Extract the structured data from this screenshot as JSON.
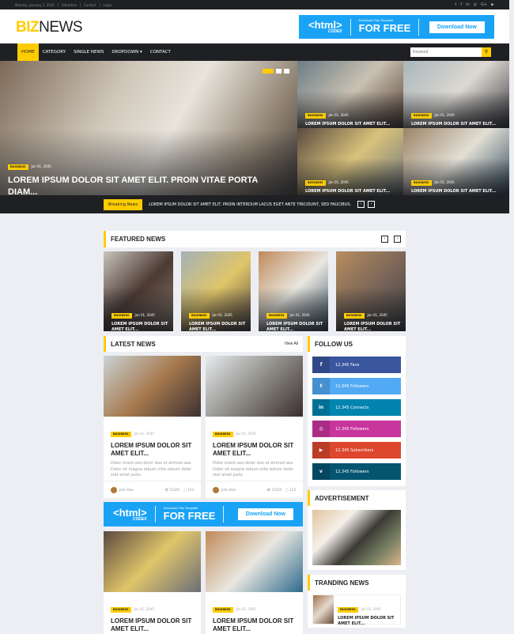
{
  "topbar": {
    "date": "Monday, January 1, 2045",
    "links": [
      "Advertise",
      "Contact",
      "Login"
    ],
    "social_icons": [
      "twitter-icon",
      "facebook-icon",
      "linkedin-icon",
      "instagram-icon",
      "google-plus-icon",
      "youtube-icon"
    ]
  },
  "logo": {
    "part1": "BIZ",
    "part2": "NEWS"
  },
  "banner": {
    "brand": "<html>",
    "brand_sub": "CODEX",
    "small": "Download This Template",
    "big": "FOR FREE",
    "button": "Download Now"
  },
  "nav": {
    "items": [
      "HOME",
      "CATEGORY",
      "SINGLE NEWS",
      "DROPDOWN ▾",
      "CONTACT"
    ],
    "active": "HOME",
    "search_placeholder": "Keyword"
  },
  "hero": {
    "main": {
      "tag": "BUSINESS",
      "date": "Jan 01, 2045",
      "title": "LOREM IPSUM DOLOR SIT AMET ELIT. PROIN VITAE PORTA DIAM..."
    },
    "tiles": [
      {
        "tag": "BUSINESS",
        "date": "Jan 01, 2045",
        "title": "LOREM IPSUM DOLOR SIT AMET ELIT..."
      },
      {
        "tag": "BUSINESS",
        "date": "Jan 01, 2045",
        "title": "LOREM IPSUM DOLOR SIT AMET ELIT..."
      },
      {
        "tag": "BUSINESS",
        "date": "Jan 01, 2045",
        "title": "LOREM IPSUM DOLOR SIT AMET ELIT..."
      },
      {
        "tag": "BUSINESS",
        "date": "Jan 01, 2045",
        "title": "LOREM IPSUM DOLOR SIT AMET ELIT..."
      }
    ]
  },
  "breaking": {
    "label": "Breaking News",
    "text": "LOREM IPSUM DOLOR SIT AMET ELIT. PROIN INTERDUM LACUS EGET ANTE TINCIDUNT, SED FAUCIBUS."
  },
  "featured": {
    "title": "FEATURED NEWS",
    "items": [
      {
        "tag": "BUSINESS",
        "date": "Jan 01, 2045",
        "title": "LOREM IPSUM DOLOR SIT AMET ELIT..."
      },
      {
        "tag": "BUSINESS",
        "date": "Jan 01, 2045",
        "title": "LOREM IPSUM DOLOR SIT AMET ELIT..."
      },
      {
        "tag": "BUSINESS",
        "date": "Jan 01, 2045",
        "title": "LOREM IPSUM DOLOR SIT AMET ELIT..."
      },
      {
        "tag": "BUSINESS",
        "date": "Jan 01, 2045",
        "title": "LOREM IPSUM DOLOR SIT AMET ELIT..."
      }
    ]
  },
  "latest": {
    "title": "LATEST NEWS",
    "view_all": "View All",
    "items": [
      {
        "tag": "BUSINESS",
        "date": "Jan 01, 2045",
        "title": "LOREM IPSUM DOLOR SIT AMET ELIT...",
        "desc": "Dolor lorem eos dolor duo et eirmod sea. Dolor sit magna rebum clita rebum dolor stet amet justo",
        "author": "John Doe",
        "views": "12345",
        "comments": "123"
      },
      {
        "tag": "BUSINESS",
        "date": "Jan 01, 2045",
        "title": "LOREM IPSUM DOLOR SIT AMET ELIT...",
        "desc": "Dolor lorem eos dolor duo et eirmod sea. Dolor sit magna rebum clita rebum dolor stet amet justo",
        "author": "John Doe",
        "views": "12345",
        "comments": "123"
      },
      {
        "tag": "BUSINESS",
        "date": "Jan 01, 2045",
        "title": "LOREM IPSUM DOLOR SIT AMET ELIT..."
      },
      {
        "tag": "BUSINESS",
        "date": "Jan 01, 2045",
        "title": "LOREM IPSUM DOLOR SIT AMET ELIT..."
      }
    ]
  },
  "follow": {
    "title": "FOLLOW US",
    "items": [
      {
        "icon": "f",
        "label": "12,345 Fans",
        "color": "#39569e"
      },
      {
        "icon": "t",
        "label": "12,345 Followers",
        "color": "#52aaf4"
      },
      {
        "icon": "in",
        "label": "12,345 Connects",
        "color": "#0185ae"
      },
      {
        "icon": "◎",
        "label": "12,345 Followers",
        "color": "#c8359d"
      },
      {
        "icon": "▶",
        "label": "12,345 Subscribers",
        "color": "#dc472e"
      },
      {
        "icon": "v",
        "label": "12,345 Followers",
        "color": "#055570"
      }
    ]
  },
  "advertisement": {
    "title": "ADVERTISEMENT"
  },
  "trending": {
    "title": "TRANDING NEWS",
    "items": [
      {
        "tag": "BUSINESS",
        "date": "Jan 01, 2045",
        "title": "LOREM IPSUM DOLOR SIT AMET ELIT..."
      }
    ]
  }
}
